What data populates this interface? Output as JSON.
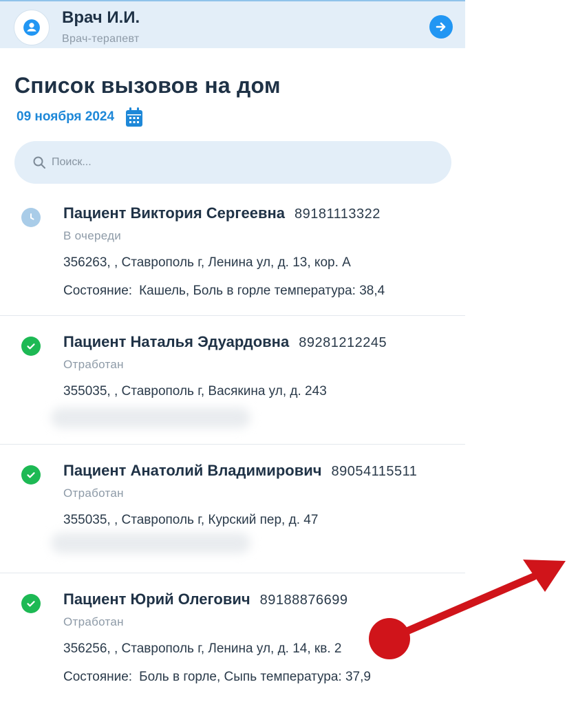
{
  "header": {
    "user_name": "Врач И.И.",
    "user_role": "Врач-терапевт",
    "avatar_icon": "user-icon",
    "logout_icon": "arrow-right-circle-icon"
  },
  "page": {
    "title": "Список вызовов на дом",
    "date": "09 ноября 2024",
    "calendar_icon": "calendar-icon"
  },
  "search": {
    "placeholder": "Поиск...",
    "icon": "search-icon"
  },
  "patients": [
    {
      "name": "Пациент Виктория Сергеевна",
      "phone": "89181113322",
      "status": "В очереди",
      "status_icon": "clock-icon",
      "address": "356263, , Ставрополь г, Ленина ул, д. 13, кор. А",
      "condition_label": "Состояние:",
      "condition": "Кашель, Боль в горле  температура: 38,4"
    },
    {
      "name": "Пациент Наталья Эдуардовна",
      "phone": "89281212245",
      "status": "Отработан",
      "status_icon": "check-circle-icon",
      "address": "355035, , Ставрополь г, Васякина ул, д. 243"
    },
    {
      "name": "Пациент Анатолий Владимирович",
      "phone": "89054115511",
      "status": "Отработан",
      "status_icon": "check-circle-icon",
      "address": "355035, , Ставрополь г, Курский пер, д. 47"
    },
    {
      "name": "Пациент Юрий Олегович",
      "phone": "89188876699",
      "status": "Отработан",
      "status_icon": "check-circle-icon",
      "address": "356256, , Ставрополь г, Ленина ул, д. 14, кв. 2",
      "condition_label": "Состояние:",
      "condition": "Боль в горле, Сыпь  температура: 37,9"
    }
  ],
  "colors": {
    "accent": "#2196f3",
    "header_bg": "#e3eef8",
    "done": "#1db954",
    "queue": "#a9cce8",
    "annotation": "#d0141a"
  }
}
